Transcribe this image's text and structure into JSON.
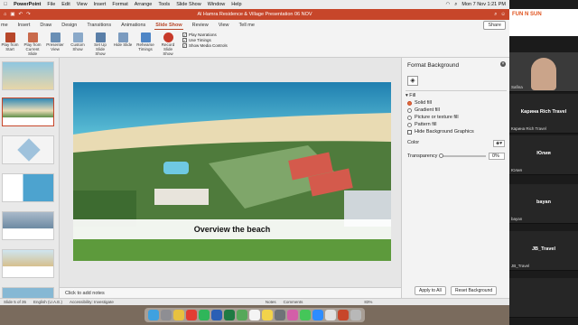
{
  "mac_menu": {
    "app": "PowerPoint",
    "items": [
      "File",
      "Edit",
      "View",
      "Insert",
      "Format",
      "Arrange",
      "Tools",
      "Slide Show",
      "Window",
      "Help"
    ],
    "clock": "Mon 7 Nov  1:21 PM"
  },
  "window_title": "Al Hamra Residence & Village Presentation 06 NOV",
  "ribbon_tabs": [
    "me",
    "Insert",
    "Draw",
    "Design",
    "Transitions",
    "Animations",
    "Slide Show",
    "Review",
    "View",
    "Tell me"
  ],
  "share_label": "Share",
  "ribbon_buttons": [
    {
      "label": "Play from Start",
      "icon": "play-icon"
    },
    {
      "label": "Play from Current Slide",
      "icon": "play-current-icon"
    },
    {
      "label": "Presenter View",
      "icon": "presenter-icon"
    },
    {
      "label": "Custom Show",
      "icon": "custom-show-icon"
    },
    {
      "label": "Set Up Slide Show",
      "icon": "setup-icon"
    },
    {
      "label": "Hide Slide",
      "icon": "hide-slide-icon"
    },
    {
      "label": "Rehearse Timings",
      "icon": "timer-icon"
    },
    {
      "label": "Record Slide Show",
      "icon": "record-icon"
    }
  ],
  "ribbon_checks": [
    {
      "label": "Play Narrations",
      "checked": true
    },
    {
      "label": "Use Timings",
      "checked": true
    },
    {
      "label": "Show Media Controls",
      "checked": true
    }
  ],
  "slide": {
    "caption": "Overview the beach"
  },
  "notes_placeholder": "Click to add notes",
  "format_pane": {
    "title": "Format Background",
    "section": "Fill",
    "fill_options": [
      {
        "label": "Solid fill",
        "selected": true
      },
      {
        "label": "Gradient fill",
        "selected": false
      },
      {
        "label": "Picture or texture fill",
        "selected": false
      },
      {
        "label": "Pattern fill",
        "selected": false
      }
    ],
    "hide_graphics": "Hide Background Graphics",
    "color_label": "Color",
    "transparency_label": "Transparency",
    "transparency_value": "0%",
    "apply_all": "Apply to All",
    "reset": "Reset Background"
  },
  "status": {
    "slide": "Slide 5 of 35",
    "language": "English (U.A.E.)",
    "accessibility": "Accessibility: Investigate",
    "notes": "Notes",
    "comments": "Comments",
    "zoom": "83%"
  },
  "participants": [
    {
      "name": "",
      "sub": "Safina"
    },
    {
      "name": "Карина Rich Travel",
      "sub": "Карина Rich Travel"
    },
    {
      "name": "Юлия",
      "sub": "Юлия"
    },
    {
      "name": "bayan",
      "sub": "bayan"
    },
    {
      "name": "JB_Travel",
      "sub": "JB_Travel"
    },
    {
      "name": "",
      "sub": ""
    }
  ],
  "logo_text": "FUN N SUN"
}
